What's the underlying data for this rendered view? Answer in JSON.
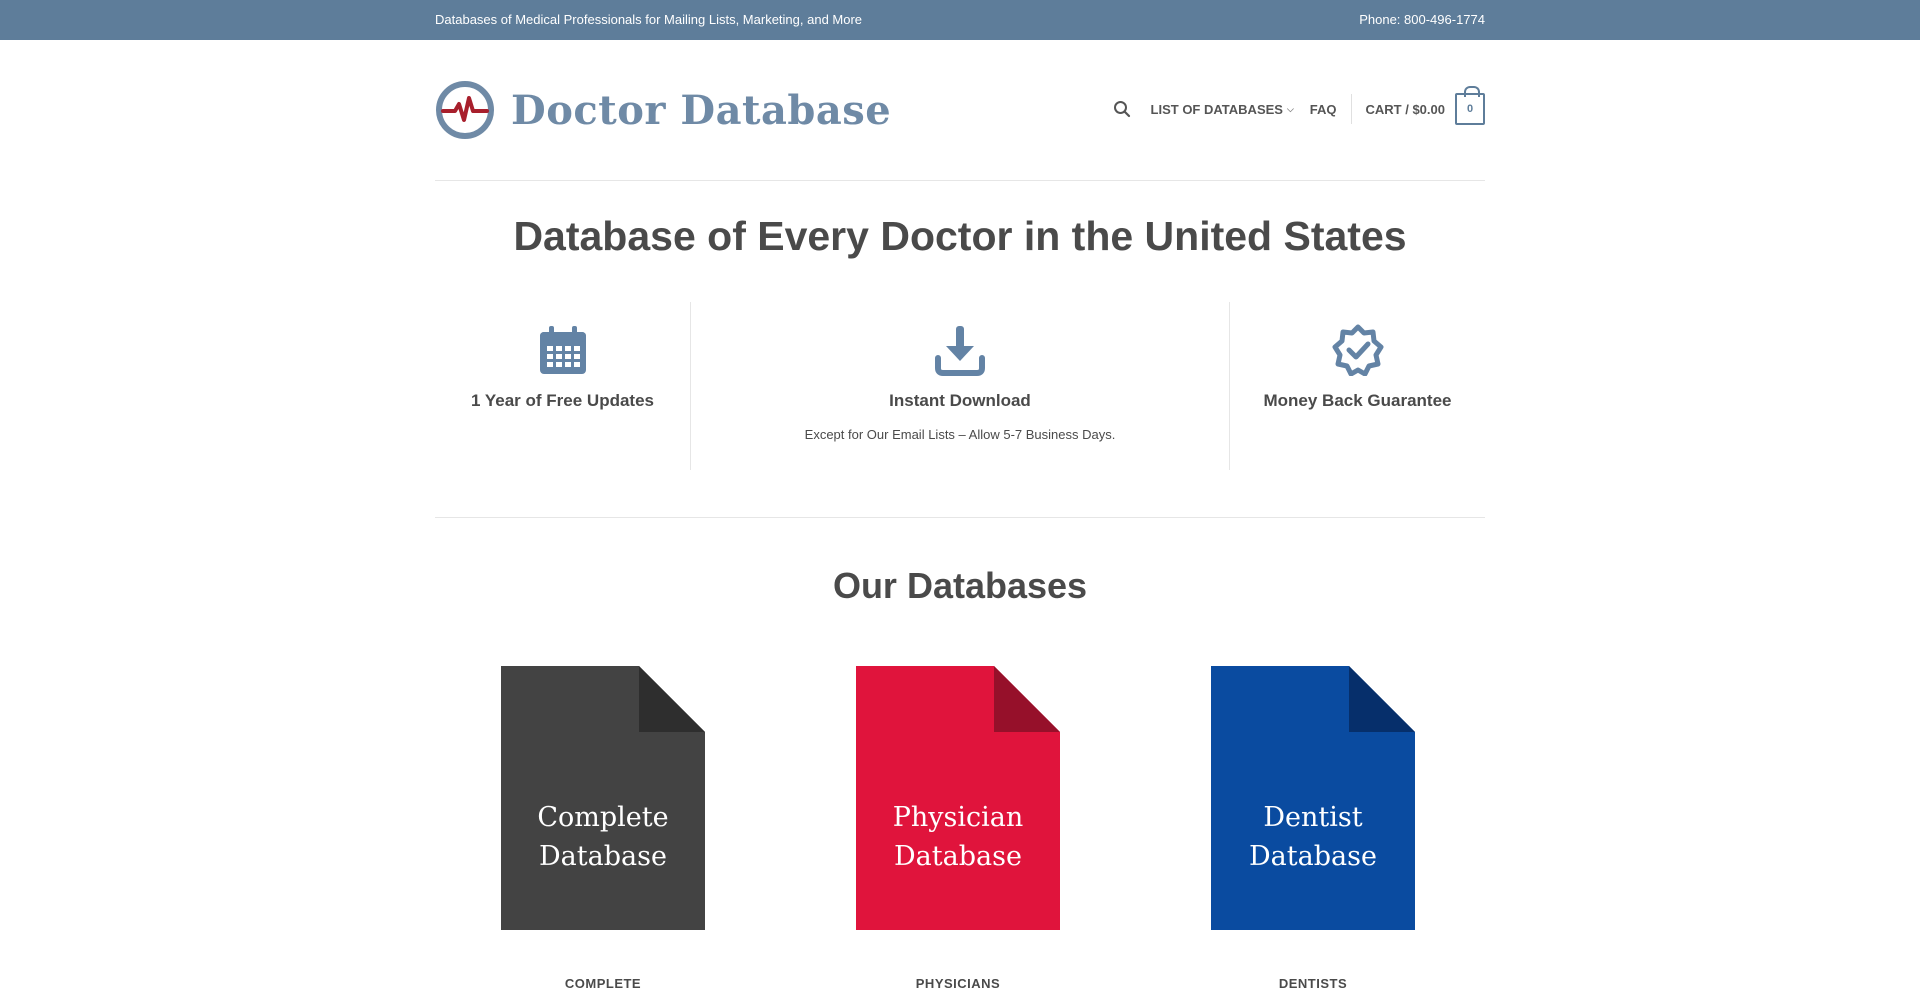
{
  "topbar": {
    "tagline": "Databases of Medical Professionals for Mailing Lists, Marketing, and More",
    "phone": "Phone: 800-496-1774"
  },
  "header": {
    "logo_text": "Doctor Database",
    "logo_colors": {
      "ring": "#6f8aa6",
      "pulse": "#a81f2c"
    }
  },
  "nav": {
    "list_of_databases": "LIST OF DATABASES",
    "faq": "FAQ",
    "cart_label": "CART / $0.00",
    "cart_count": "0"
  },
  "hero": {
    "title": "Database of Every Doctor in the United States"
  },
  "features": [
    {
      "icon": "calendar-icon",
      "title": "1 Year of Free Updates",
      "desc": ""
    },
    {
      "icon": "download-icon",
      "title": "Instant Download",
      "desc": "Except for Our Email Lists – Allow 5-7 Business Days."
    },
    {
      "icon": "badge-check-icon",
      "title": "Money Back Guarantee",
      "desc": ""
    }
  ],
  "databases_section": {
    "title": "Our Databases",
    "cards": [
      {
        "line1": "Complete",
        "line2": "Database",
        "caption": "COMPLETE",
        "color": "#434343",
        "fold_color": "#2e2e2e"
      },
      {
        "line1": "Physician",
        "line2": "Database",
        "caption": "PHYSICIANS",
        "color": "#e0143c",
        "fold_color": "#96102a"
      },
      {
        "line1": "Dentist",
        "line2": "Database",
        "caption": "DENTISTS",
        "color": "#0a4ba0",
        "fold_color": "#062f6b"
      }
    ]
  },
  "colors": {
    "accent": "#5e7d9a",
    "text": "#4a4a4a",
    "icon": "#6383a5"
  }
}
